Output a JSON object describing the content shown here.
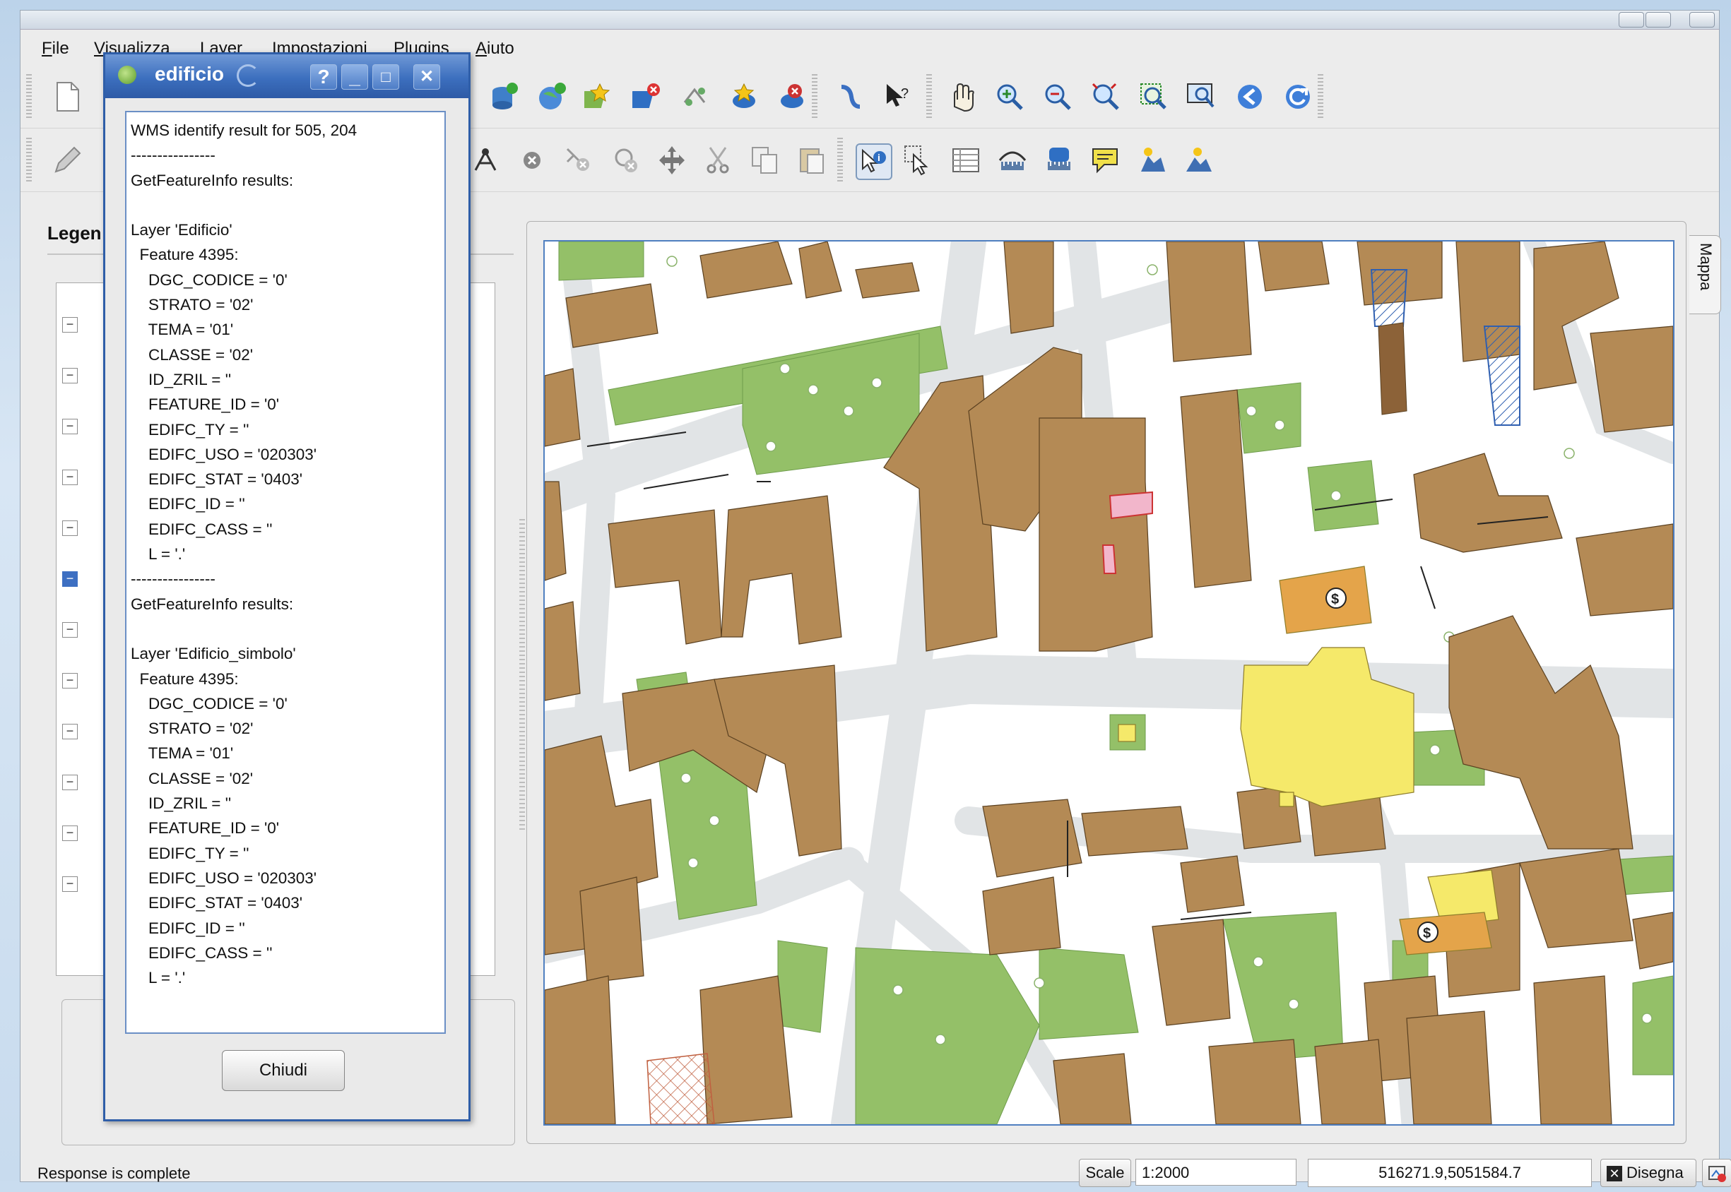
{
  "menu": {
    "items": [
      "File",
      "Visualizza",
      "Layer",
      "Impostazioni",
      "Plugins",
      "Aiuto"
    ]
  },
  "toolbar1": {
    "icons": [
      "new-project-icon",
      "save-icon",
      "add-vector-layer-icon",
      "add-raster-layer-icon",
      "add-postgis-layer-icon",
      "add-wms-layer-icon",
      "remove-layer-icon",
      "add-spatialite-layer-icon",
      "new-bookmark-icon",
      "remove-bookmark-icon",
      "show-bookmarks-icon",
      "help-icon",
      "pan-icon",
      "zoom-in-icon",
      "zoom-out-icon",
      "zoom-full-icon",
      "zoom-layer-icon",
      "zoom-selection-icon",
      "zoom-last-icon",
      "refresh-icon"
    ]
  },
  "toolbar2": {
    "icons": [
      "edit-pencil-icon",
      "node-tool-icon",
      "delete-selected-icon",
      "delete-part-icon",
      "delete-ring-icon",
      "move-feature-icon",
      "cut-icon",
      "copy-icon",
      "paste-icon",
      "identify-icon",
      "select-icon",
      "attribute-table-icon",
      "measure-line-icon",
      "measure-area-icon",
      "map-tips-icon",
      "add-text-annotation-icon",
      "add-form-annotation-icon"
    ]
  },
  "legend": {
    "title": "Legen"
  },
  "map": {
    "tab_label": "Mappa"
  },
  "dialog": {
    "title": "edificio",
    "help_button": "?",
    "minimize_button": "_",
    "maximize_button": "□",
    "close_button": "✕",
    "result_text": "WMS identify result for 505, 204\n----------------\nGetFeatureInfo results:\n\nLayer 'Edificio'\n  Feature 4395:\n    DGC_CODICE = '0'\n    STRATO = '02'\n    TEMA = '01'\n    CLASSE = '02'\n    ID_ZRIL = ''\n    FEATURE_ID = '0'\n    EDIFC_TY = ''\n    EDIFC_USO = '020303'\n    EDIFC_STAT = '0403'\n    EDIFC_ID = ''\n    EDIFC_CASS = ''\n    L = '.'\n----------------\nGetFeatureInfo results:\n\nLayer 'Edificio_simbolo'\n  Feature 4395:\n    DGC_CODICE = '0'\n    STRATO = '02'\n    TEMA = '01'\n    CLASSE = '02'\n    ID_ZRIL = ''\n    FEATURE_ID = '0'\n    EDIFC_TY = ''\n    EDIFC_USO = '020303'\n    EDIFC_STAT = '0403'\n    EDIFC_ID = ''\n    EDIFC_CASS = ''\n    L = '.'",
    "chiudi_button": "Chiudi"
  },
  "status": {
    "message": "Response is complete",
    "scale_label": "Scale",
    "scale_value": "1:2000",
    "coordinates": "516271.9,5051584.7",
    "render_label": "Disegna",
    "render_checked": true
  },
  "colors": {
    "building": "#b48a55",
    "green": "#94c068",
    "yellow": "#f5e96a",
    "orange": "#e4a44a",
    "road": "#e3e6e8",
    "dialog_border": "#2f5ea8"
  }
}
